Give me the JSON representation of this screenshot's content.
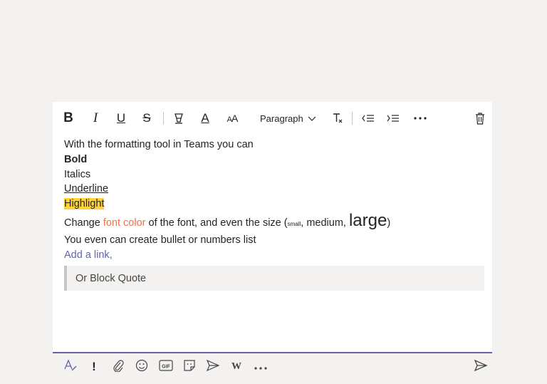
{
  "toolbar": {
    "buttons": [
      {
        "name": "bold-icon",
        "glyph": "B"
      },
      {
        "name": "italic-icon",
        "glyph": "I"
      },
      {
        "name": "underline-icon",
        "glyph": "U"
      },
      {
        "name": "strikethrough-icon",
        "glyph": "S"
      },
      {
        "name": "highlight-icon"
      },
      {
        "name": "font-color-icon",
        "glyph": "A"
      },
      {
        "name": "font-size-icon",
        "glyph": "AA"
      }
    ],
    "paragraph_label": "Paragraph"
  },
  "content": {
    "intro": "With the formatting tool in Teams you can",
    "bold": "Bold",
    "italics": "Italics",
    "underline": "Underline",
    "highlight": "Highlight",
    "change_prefix": "Change ",
    "font_color": "font color",
    "change_mid": " of the font, and even the size (",
    "small": "small",
    "comma_medium": ", medium, ",
    "large": "large",
    "close_paren": ")",
    "bullets": "You even can create bullet or numbers list",
    "link": "Add a link",
    "link_suffix": ",",
    "block_quote": "Or Block Quote"
  },
  "colors": {
    "accent": "#6264a7",
    "highlight": "#ffd335",
    "font_color": "#e97548",
    "background": "#f3f2f1"
  }
}
